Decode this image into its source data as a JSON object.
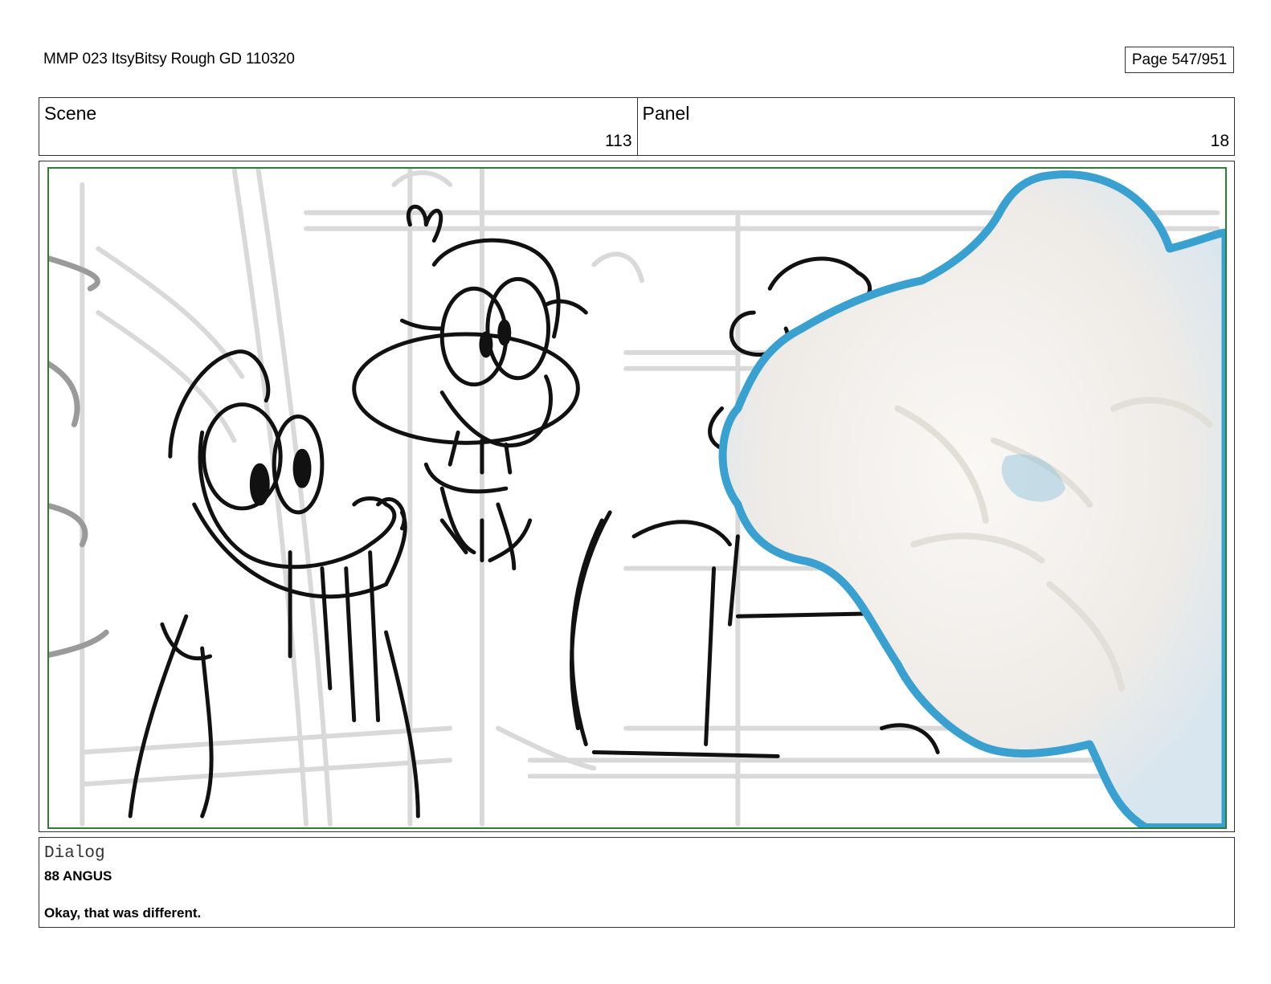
{
  "header": {
    "document_title": "MMP 023 ItsyBitsy Rough GD 110320",
    "page_indicator": "Page 547/951"
  },
  "info": {
    "scene_label": "Scene",
    "scene_value": "113",
    "panel_label": "Panel",
    "panel_value": "18"
  },
  "dialog": {
    "label": "Dialog",
    "speaker": "88 ANGUS",
    "line": "Okay, that was different."
  },
  "colors": {
    "frame_border": "#2e7d32",
    "sketch_line": "#111111",
    "background_sketch": "#d9d9d9",
    "cotton_fill": "#f3f1ee",
    "cotton_edge": "#3aa0d0"
  }
}
